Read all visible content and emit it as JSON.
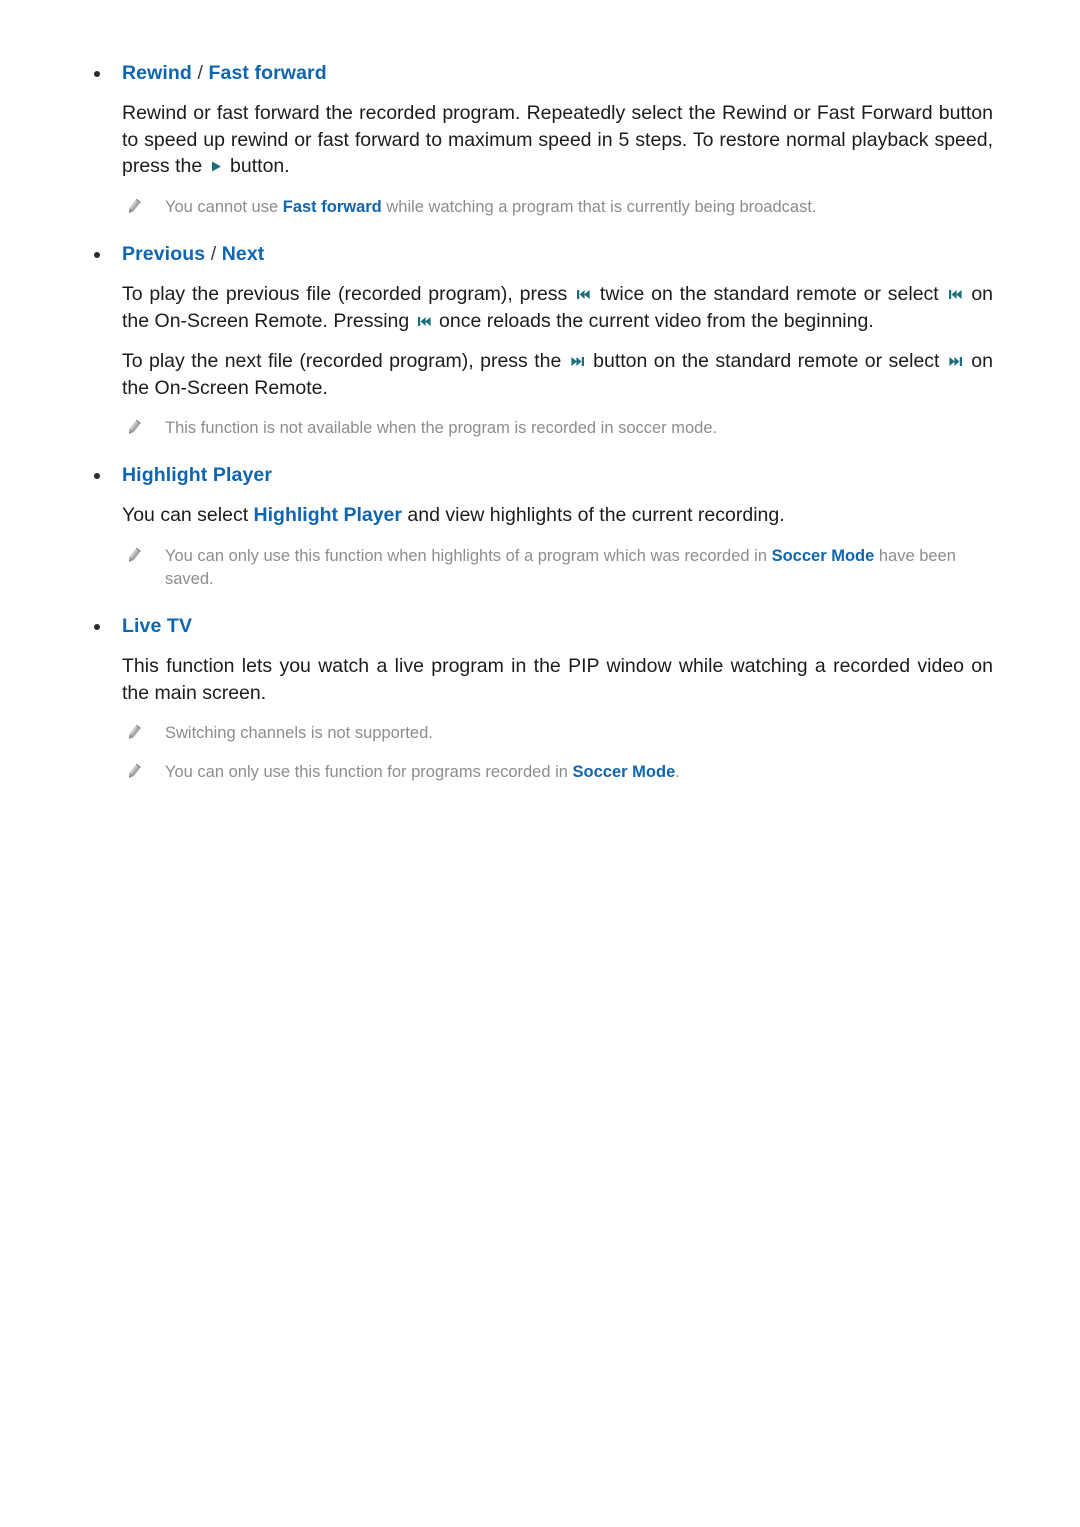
{
  "colors": {
    "heading_blue": "#1065b0",
    "body_text": "#1c1c1c",
    "note_text": "#8d8d8d",
    "glyph_teal": "#1b6e7d",
    "bullet": "#2b2b2b",
    "page_background": "#ffffff"
  },
  "sections": [
    {
      "id": "rewind-fast-forward",
      "heading": {
        "first": "Rewind",
        "separator": " / ",
        "second": "Fast forward"
      },
      "paragraph": {
        "part1": "Rewind or fast forward the recorded program. Repeatedly select the Rewind or Fast Forward button to speed up rewind or fast forward to maximum speed in 5 steps. To restore normal playback speed, press the ",
        "glyph": "play-icon",
        "part2": " button."
      },
      "notes": [
        {
          "part1": "You cannot use ",
          "highlight": "Fast forward",
          "part2": " while watching a program that is currently being broadcast."
        }
      ]
    },
    {
      "id": "previous-next",
      "heading": {
        "first": "Previous",
        "separator": " / ",
        "second": "Next"
      },
      "paragraph_previous": {
        "part1": "To play the previous file (recorded program), press ",
        "glyph1": "previous-track-icon",
        "part2": " twice on the standard remote or select ",
        "glyph2": "previous-track-icon",
        "part3": " on the On-Screen Remote. Pressing ",
        "glyph3": "previous-track-icon",
        "part4": " once reloads the current video from the beginning."
      },
      "paragraph_next": {
        "part1": "To play the next file (recorded program), press the ",
        "glyph1": "next-track-icon",
        "part2": " button on the standard remote or select ",
        "glyph2": "next-track-icon",
        "part3": " on the On-Screen Remote."
      },
      "notes": [
        {
          "part1": "This function is not available when the program is recorded in soccer mode.",
          "highlight": "",
          "part2": ""
        }
      ]
    },
    {
      "id": "highlight-player",
      "heading": {
        "first": "Highlight Player",
        "separator": "",
        "second": ""
      },
      "paragraph": {
        "part1": "You can select ",
        "highlight": "Highlight Player",
        "part2": " and view highlights of the current recording."
      },
      "notes": [
        {
          "part1": "You can only use this function when highlights of a program which was recorded in ",
          "highlight": "Soccer Mode",
          "part2": " have been saved."
        }
      ]
    },
    {
      "id": "live-tv",
      "heading": {
        "first": "Live TV",
        "separator": "",
        "second": ""
      },
      "paragraph": {
        "part1": "This function lets you watch a live program in the PIP window while watching a recorded video on the main screen."
      },
      "notes": [
        {
          "part1": "Switching channels is not supported.",
          "highlight": "",
          "part2": ""
        },
        {
          "part1": "You can only use this function for programs recorded in ",
          "highlight": "Soccer Mode",
          "part2": "."
        }
      ]
    }
  ]
}
